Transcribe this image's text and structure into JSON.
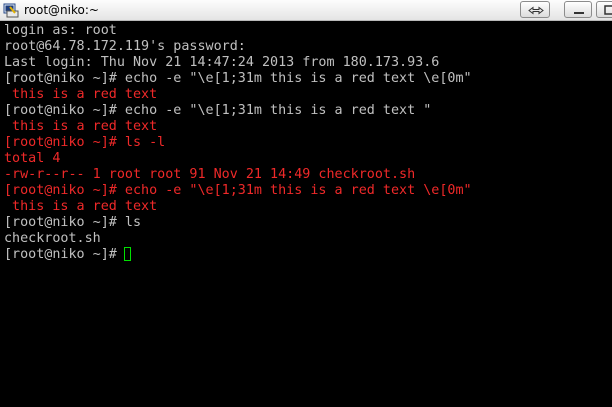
{
  "window": {
    "title": "root@niko:~",
    "icon": "putty-terminal-icon",
    "controls": [
      "restore-icon",
      "minimize-icon",
      "maximize-icon"
    ]
  },
  "colors": {
    "background": "#000000",
    "normal_text": "#c0c0c0",
    "red_text": "#ef2929",
    "cursor": "#00e000"
  },
  "terminal": {
    "lines": [
      {
        "text": "login as: root",
        "color": "normal"
      },
      {
        "text": "root@64.78.172.119's password:",
        "color": "normal"
      },
      {
        "text": "Last login: Thu Nov 21 14:47:24 2013 from 180.173.93.6",
        "color": "normal"
      },
      {
        "text": "[root@niko ~]# echo -e \"\\e[1;31m this is a red text \\e[0m\"",
        "color": "normal"
      },
      {
        "text": " this is a red text",
        "color": "red"
      },
      {
        "text": "[root@niko ~]# echo -e \"\\e[1;31m this is a red text \"",
        "color": "normal"
      },
      {
        "text": " this is a red text",
        "color": "red"
      },
      {
        "text": "[root@niko ~]# ls -l",
        "color": "red"
      },
      {
        "text": "total 4",
        "color": "red"
      },
      {
        "text": "-rw-r--r-- 1 root root 91 Nov 21 14:49 checkroot.sh",
        "color": "red"
      },
      {
        "text": "[root@niko ~]# echo -e \"\\e[1;31m this is a red text \\e[0m\"",
        "color": "red"
      },
      {
        "text": " this is a red text",
        "color": "red"
      },
      {
        "text": "[root@niko ~]# ls",
        "color": "normal"
      },
      {
        "text": "checkroot.sh",
        "color": "normal"
      },
      {
        "text": "[root@niko ~]# ",
        "color": "normal"
      }
    ]
  }
}
